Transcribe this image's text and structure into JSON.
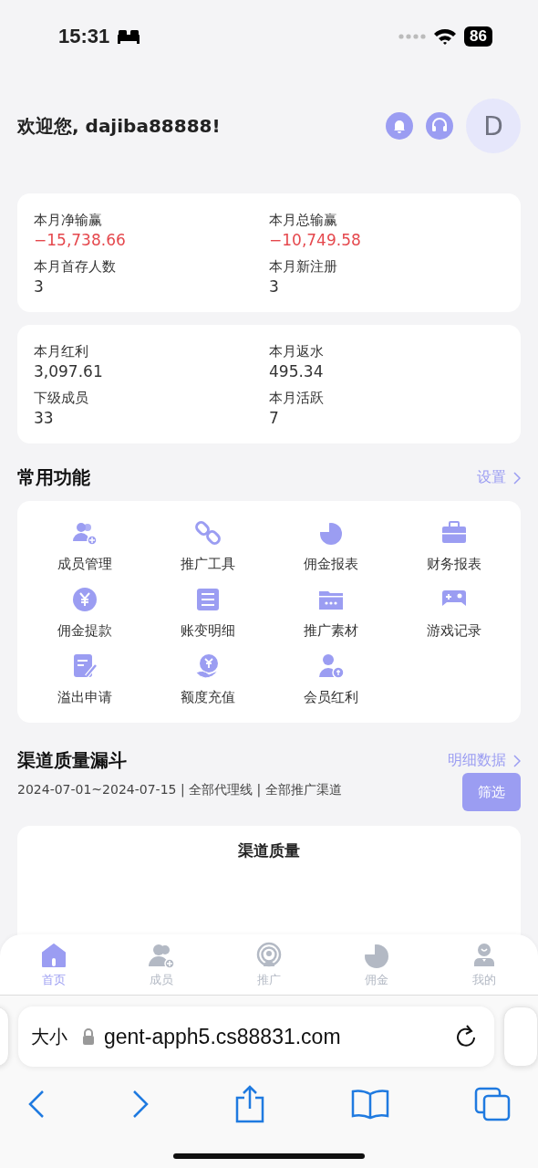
{
  "status_bar": {
    "time": "15:31",
    "battery": "86"
  },
  "header": {
    "greeting": "欢迎您, dajiba88888!",
    "avatar": "D"
  },
  "stat_cards": [
    {
      "items": [
        {
          "label": "本月净输赢",
          "value": "−15,738.66",
          "color": "#e5484d"
        },
        {
          "label": "本月总输赢",
          "value": "−10,749.58",
          "color": "#e5484d"
        },
        {
          "label": "本月首存人数",
          "value": "3",
          "color": "#333333"
        },
        {
          "label": "本月新注册",
          "value": "3",
          "color": "#333333"
        }
      ]
    },
    {
      "items": [
        {
          "label": "本月红利",
          "value": "3,097.61",
          "color": "#333333"
        },
        {
          "label": "本月返水",
          "value": "495.34",
          "color": "#333333"
        },
        {
          "label": "下级成员",
          "value": "33",
          "color": "#333333"
        },
        {
          "label": "本月活跃",
          "value": "7",
          "color": "#333333"
        }
      ]
    }
  ],
  "functions": {
    "title": "常用功能",
    "link": "设置",
    "items": [
      "成员管理",
      "推广工具",
      "佣金报表",
      "财务报表",
      "佣金提款",
      "账变明细",
      "推广素材",
      "游戏记录",
      "溢出申请",
      "额度充值",
      "会员红利"
    ]
  },
  "funnel": {
    "title": "渠道质量漏斗",
    "link": "明细数据",
    "filter_text": "2024-07-01~2024-07-15 | 全部代理线 | 全部推广渠道",
    "filter_button": "筛选",
    "card_title": "渠道质量"
  },
  "tab_bar": [
    {
      "label": "首页",
      "selected": true
    },
    {
      "label": "成员",
      "selected": false
    },
    {
      "label": "推广",
      "selected": false
    },
    {
      "label": "佣金",
      "selected": false
    },
    {
      "label": "我的",
      "selected": false
    }
  ],
  "browser": {
    "text_size": "大小",
    "url": "gent-apph5.cs88831.com"
  }
}
